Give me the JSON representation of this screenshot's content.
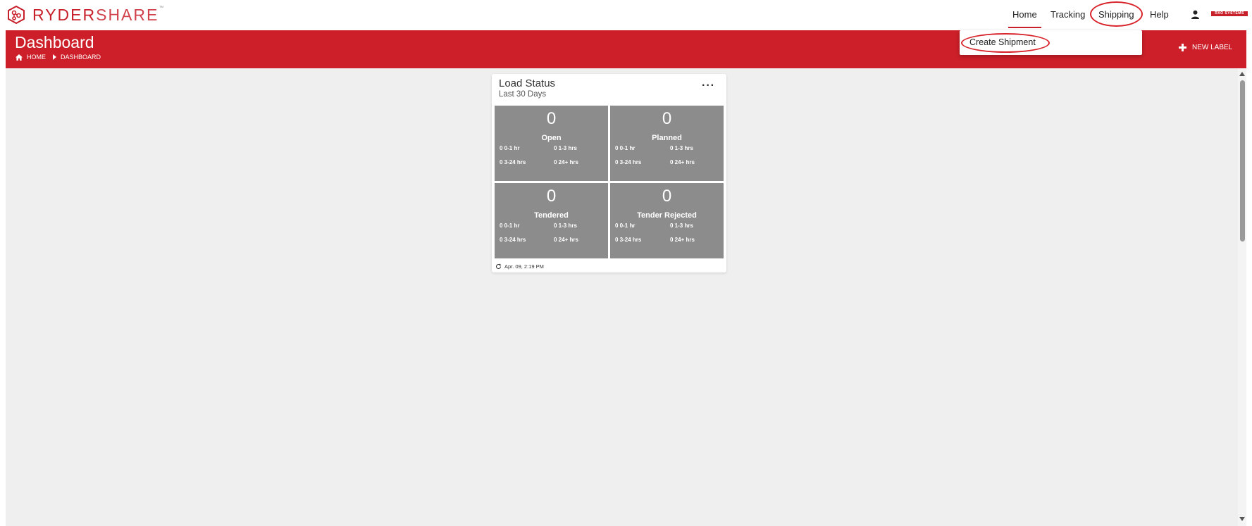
{
  "app": {
    "logo_main": "RYDER",
    "logo_accent": "SHARE",
    "logo_tm": "™",
    "brand_tag": "RXO SYSTEMS"
  },
  "nav": {
    "home": "Home",
    "tracking": "Tracking",
    "shipping": "Shipping",
    "help": "Help"
  },
  "dropdown": {
    "create_shipment": "Create Shipment"
  },
  "header": {
    "title": "Dashboard",
    "breadcrumb_home": "HOME",
    "breadcrumb_current": "DASHBOARD",
    "new_label": "NEW LABEL"
  },
  "card": {
    "title": "Load Status",
    "subtitle": "Last 30 Days",
    "menu": "···",
    "footer_time": "Apr. 09, 2:19 PM",
    "tiles": [
      {
        "count": "0",
        "label": "Open",
        "s1": "0 0-1 hr",
        "s2": "0 1-3 hrs",
        "s3": "0 3-24 hrs",
        "s4": "0 24+ hrs"
      },
      {
        "count": "0",
        "label": "Planned",
        "s1": "0 0-1 hr",
        "s2": "0 1-3 hrs",
        "s3": "0 3-24 hrs",
        "s4": "0 24+ hrs"
      },
      {
        "count": "0",
        "label": "Tendered",
        "s1": "0 0-1 hr",
        "s2": "0 1-3 hrs",
        "s3": "0 3-24 hrs",
        "s4": "0 24+ hrs"
      },
      {
        "count": "0",
        "label": "Tender Rejected",
        "s1": "0 0-1 hr",
        "s2": "0 1-3 hrs",
        "s3": "0 3-24 hrs",
        "s4": "0 24+ hrs"
      }
    ]
  },
  "colors": {
    "brand_red": "#cc1f29",
    "tile_gray": "#8c8c8d",
    "highlight_circle": "#d8232a"
  },
  "icons": {
    "logo": "ryder-hex-logo-icon",
    "user": "user-icon",
    "home": "home-icon",
    "breadcrumb_sep": "caret-right-icon",
    "plus": "plus-icon",
    "refresh": "refresh-icon"
  }
}
